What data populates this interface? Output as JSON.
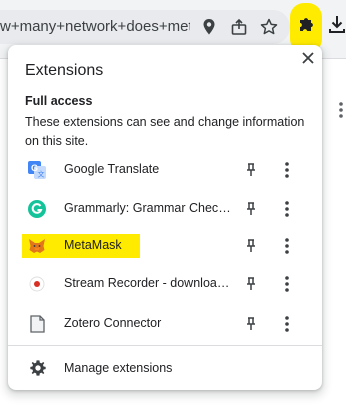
{
  "toolbar": {
    "url_text": "w+many+network+does+met...",
    "icons": [
      "location-icon",
      "share-icon",
      "bookmark-star-icon",
      "extensions-puzzle-icon",
      "download-icon"
    ]
  },
  "popup": {
    "title": "Extensions",
    "section_title": "Full access",
    "section_desc": "These extensions can see and change information on this site.",
    "extensions": [
      {
        "name": "Google Translate",
        "icon": "google-translate-icon"
      },
      {
        "name": "Grammarly: Grammar Checke...",
        "icon": "grammarly-icon"
      },
      {
        "name": "MetaMask",
        "icon": "metamask-fox-icon"
      },
      {
        "name": "Stream Recorder - download...",
        "icon": "stream-recorder-icon"
      },
      {
        "name": "Zotero Connector",
        "icon": "zotero-icon"
      }
    ],
    "manage_label": "Manage extensions"
  },
  "colors": {
    "highlight": "#ffeb00",
    "grammarly": "#15c39a",
    "translate": "#4285f4",
    "recorder": "#d93025"
  }
}
